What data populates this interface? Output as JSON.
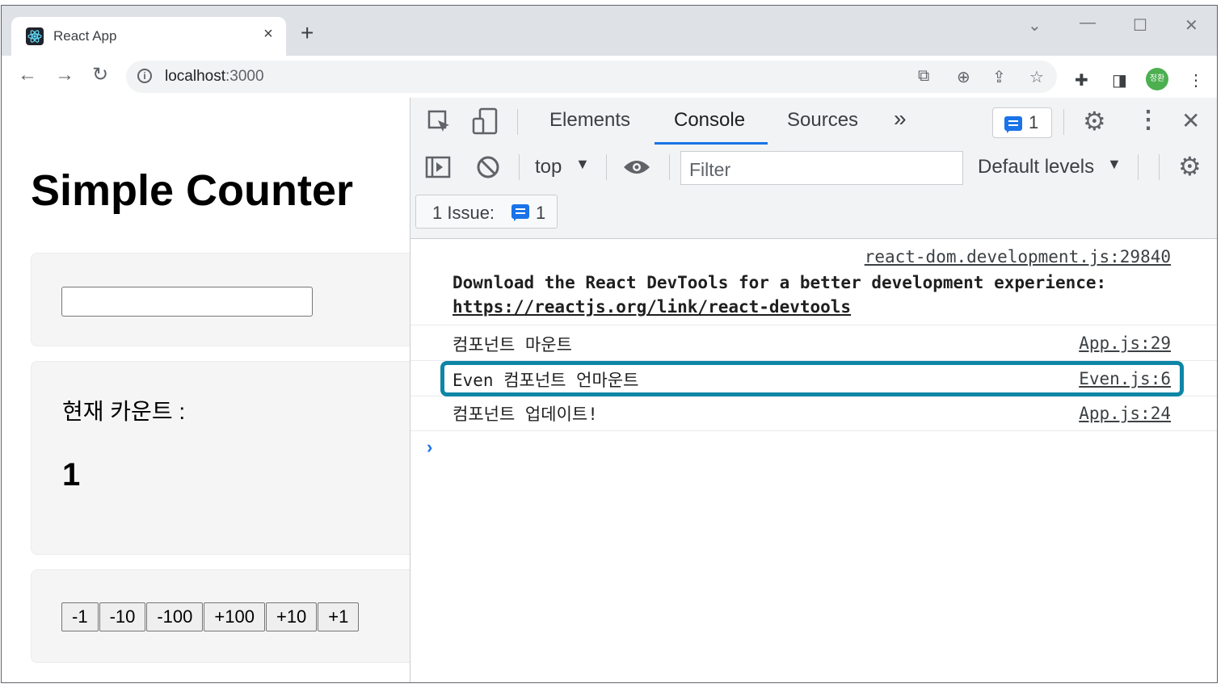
{
  "browser": {
    "tab_title": "React App",
    "tab_close": "×",
    "new_tab": "+",
    "url_host": "localhost",
    "url_port": ":3000",
    "profile_initials": "정환"
  },
  "page": {
    "title": "Simple Counter",
    "count_label": "현재 카운트 :",
    "count_value": "1",
    "input_value": "",
    "buttons": [
      "-1",
      "-10",
      "-100",
      "+100",
      "+10",
      "+1"
    ]
  },
  "devtools": {
    "tabs": [
      "Elements",
      "Console",
      "Sources"
    ],
    "more_tabs": "»",
    "issues_badge_count": "1",
    "context": "top",
    "filter_placeholder": "Filter",
    "levels": "Default levels",
    "issues_label": "1 Issue:",
    "issues_count": "1",
    "messages": [
      {
        "source": "react-dom.development.js:29840",
        "text": "Download the React DevTools for a better development experience:",
        "link": "https://reactjs.org/link/react-devtools"
      },
      {
        "text": "컴포넌트 마운트",
        "source": "App.js:29"
      },
      {
        "text": "Even 컴포넌트 언마운트",
        "source": "Even.js:6"
      },
      {
        "text": "컴포넌트 업데이트!",
        "source": "App.js:24"
      }
    ]
  },
  "colors": {
    "accent": "#1a73e8",
    "highlight_border": "#0e86a6",
    "avatar": "#4caf50"
  }
}
